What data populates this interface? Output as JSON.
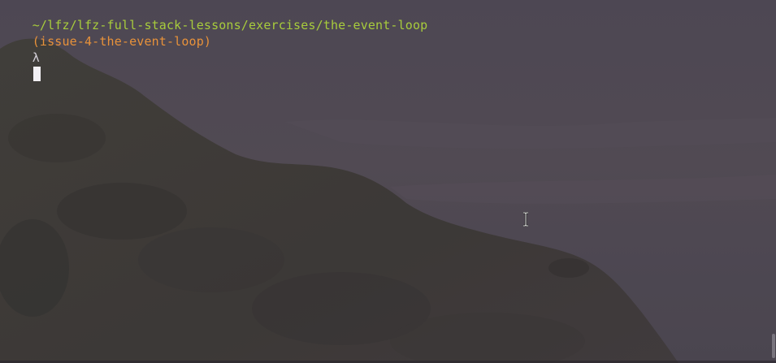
{
  "terminal": {
    "prompt": {
      "path": "~/lfz/lfz-full-stack-lessons/exercises/the-event-loop",
      "branch": "(issue-4-the-event-loop)",
      "symbol": "λ"
    },
    "colors": {
      "path": "#a8cc3c",
      "branch": "#e8923a",
      "symbol": "#d4d0d8",
      "cursor": "#f2f0f4"
    },
    "icons": {
      "mouse_pointer": "text-cursor-ibeam-icon",
      "caret": "block-cursor"
    }
  }
}
